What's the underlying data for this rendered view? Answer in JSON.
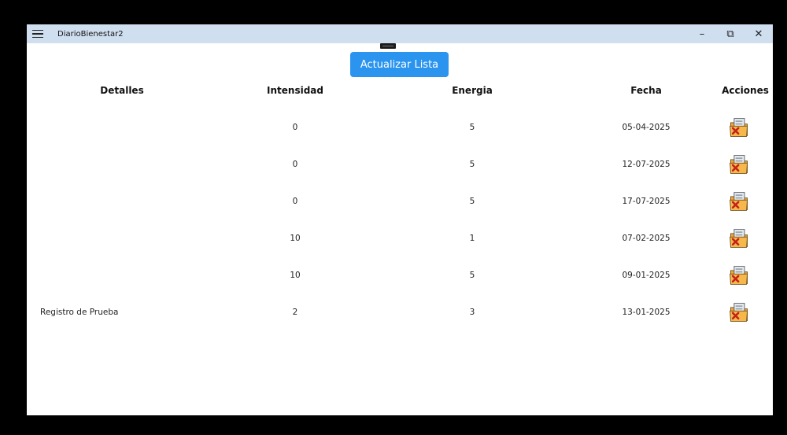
{
  "window": {
    "title": "DiarioBienestar2",
    "controls": {
      "minimize": "–",
      "restore": "⧉",
      "close": "✕"
    }
  },
  "toolbar": {
    "refresh_label": "Actualizar Lista"
  },
  "colors": {
    "titlebar": "#cfdff0",
    "accent": "#2a94ef"
  },
  "table": {
    "headers": {
      "detalles": "Detalles",
      "intensidad": "Intensidad",
      "energia": "Energia",
      "fecha": "Fecha",
      "acciones": "Acciones"
    },
    "rows": [
      {
        "detalles": "",
        "intensidad": "0",
        "energia": "5",
        "fecha": "05-04-2025",
        "action_icon": "delete-folder-icon"
      },
      {
        "detalles": "",
        "intensidad": "0",
        "energia": "5",
        "fecha": "12-07-2025",
        "action_icon": "delete-folder-icon"
      },
      {
        "detalles": "",
        "intensidad": "0",
        "energia": "5",
        "fecha": "17-07-2025",
        "action_icon": "delete-folder-icon"
      },
      {
        "detalles": "",
        "intensidad": "10",
        "energia": "1",
        "fecha": "07-02-2025",
        "action_icon": "delete-folder-icon"
      },
      {
        "detalles": "",
        "intensidad": "10",
        "energia": "5",
        "fecha": "09-01-2025",
        "action_icon": "delete-folder-icon"
      },
      {
        "detalles": "Registro de Prueba",
        "intensidad": "2",
        "energia": "3",
        "fecha": "13-01-2025",
        "action_icon": "delete-folder-icon"
      }
    ]
  }
}
